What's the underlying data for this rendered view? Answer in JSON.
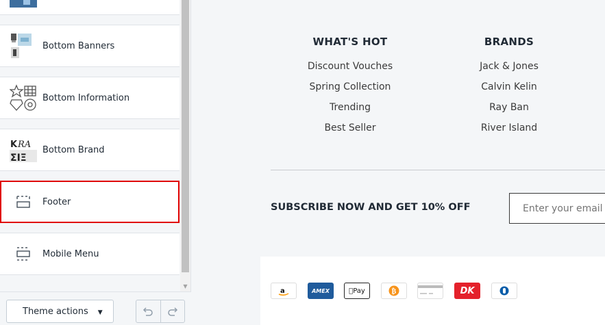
{
  "sidebar": {
    "sections": [
      {
        "label": "Bottom Banners"
      },
      {
        "label": "Bottom Information"
      },
      {
        "label": "Bottom Brand"
      },
      {
        "label": "Footer"
      },
      {
        "label": "Mobile Menu"
      }
    ],
    "theme_actions_label": "Theme actions"
  },
  "preview": {
    "columns": [
      {
        "title": "WHAT'S HOT",
        "links": [
          "Discount Vouches",
          "Spring Collection",
          "Trending",
          "Best Seller"
        ]
      },
      {
        "title": "BRANDS",
        "links": [
          "Jack & Jones",
          "Calvin Kelin",
          "Ray Ban",
          "River Island"
        ]
      }
    ],
    "subscribe": {
      "text": "SUBSCRIBE NOW AND GET 10% OFF",
      "placeholder": "Enter your email"
    },
    "payment_icons": [
      "amazon-pay-icon",
      "amex-icon",
      "apple-pay-icon",
      "bitcoin-icon",
      "generic-card-icon",
      "dankort-icon",
      "diners-club-icon"
    ],
    "payment_text": {
      "amex": "AMEX",
      "apple": "Pay",
      "dankort": "DK"
    }
  },
  "colors": {
    "selected_outline": "#e00000",
    "amex_blue": "#1f5b9c",
    "bitcoin_orange": "#f7931a",
    "dankort_red": "#e4212b",
    "diners_blue": "#0a5da9"
  }
}
